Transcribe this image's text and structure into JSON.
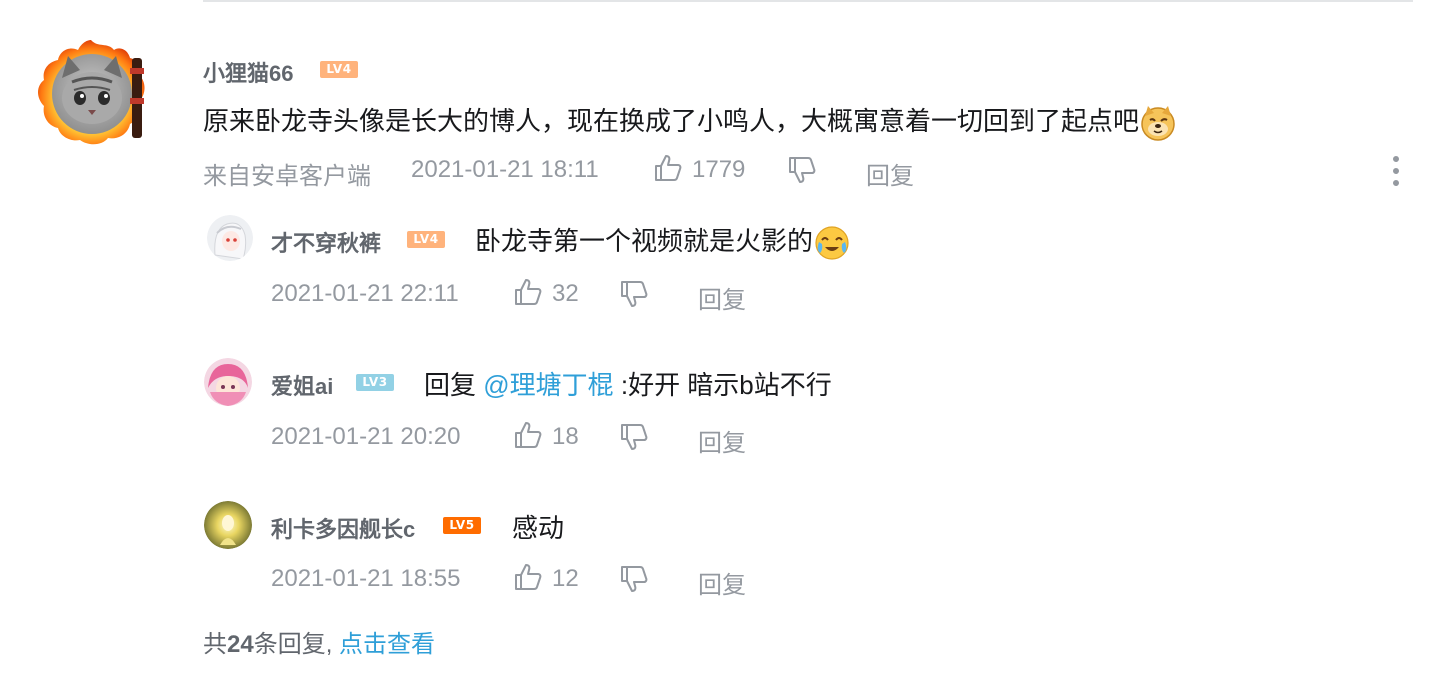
{
  "main_comment": {
    "username": "小狸猫66",
    "level": "LV4",
    "level_color": "#ffb37c",
    "text": "原来卧龙寺头像是长大的博人，现在换成了小鸣人，大概寓意着一切回到了起点吧",
    "emoji": "doge-emoji",
    "source": "来自安卓客户端",
    "time": "2021-01-21 18:11",
    "likes": "1779",
    "reply_label": "回复"
  },
  "replies": [
    {
      "username": "才不穿秋裤",
      "level": "LV4",
      "level_color": "#ffb37c",
      "text": "卧龙寺第一个视频就是火影的",
      "emoji": "crying-laugh-emoji",
      "time": "2021-01-21 22:11",
      "likes": "32",
      "reply_label": "回复"
    },
    {
      "username": "爱姐ai",
      "level": "LV3",
      "level_color": "#92d1e5",
      "prefix": "回复 ",
      "mention": "@理塘丁棍",
      "text": " :好开 暗示b站不行",
      "time": "2021-01-21 20:20",
      "likes": "18",
      "reply_label": "回复"
    },
    {
      "username": "利卡多因舰长c",
      "level": "LV5",
      "level_color": "#ff6c00",
      "text": "感动",
      "time": "2021-01-21 18:55",
      "likes": "12",
      "reply_label": "回复"
    }
  ],
  "footer": {
    "prefix": "共",
    "count": "24",
    "suffix": "条回复,",
    "view_link": "点击查看"
  }
}
